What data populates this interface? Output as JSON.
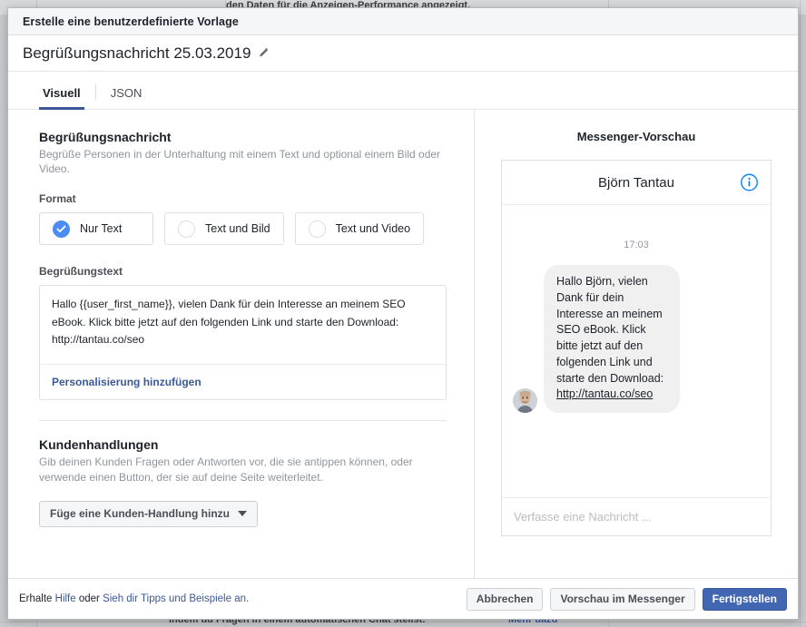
{
  "background": {
    "top_text": "den Daten für die Anzeigen-Performance angezeigt.",
    "bottom_text": "indem du Fragen in einem automatischen Chat stellst.",
    "bottom_link": "Mehr dazu"
  },
  "modal": {
    "header_title": "Erstelle eine benutzerdefinierte Vorlage",
    "doc_title": "Begrüßungsnachricht 25.03.2019",
    "edit_icon": "pencil-icon",
    "tabs": [
      {
        "label": "Visuell",
        "active": true
      },
      {
        "label": "JSON",
        "active": false
      }
    ]
  },
  "greeting_section": {
    "title": "Begrüßungsnachricht",
    "description": "Begrüße Personen in der Unterhaltung mit einem Text und optional einem Bild oder Video.",
    "format_label": "Format",
    "format_options": [
      {
        "label": "Nur Text",
        "selected": true
      },
      {
        "label": "Text und Bild",
        "selected": false
      },
      {
        "label": "Text und Video",
        "selected": false
      }
    ],
    "greeting_text_label": "Begrüßungstext",
    "greeting_text_value": "Hallo {{user_first_name}}, vielen Dank für dein Interesse an meinem SEO eBook. Klick bitte jetzt auf den folgenden Link und starte den Download: http://tantau.co/seo",
    "personalization_link": "Personalisierung hinzufügen"
  },
  "customer_actions": {
    "title": "Kundenhandlungen",
    "description": "Gib deinen Kunden Fragen oder Antworten vor, die sie antippen können, oder verwende einen Button, der sie auf deine Seite weiterleitet.",
    "add_button": "Füge eine Kunden-Handlung hinzu"
  },
  "preview": {
    "heading": "Messenger-Vorschau",
    "contact_name": "Björn Tantau",
    "info_icon": "info-circle-icon",
    "timestamp": "17:03",
    "message_text": "Hallo Björn, vielen Dank für dein Interesse an meinem SEO eBook. Klick bitte jetzt auf den folgenden Link und starte den Download: ",
    "message_link": "http://tantau.co/seo",
    "compose_placeholder": "Verfasse eine Nachricht ..."
  },
  "footer": {
    "note_prefix": "Erhalte ",
    "help_link": "Hilfe",
    "note_middle": " oder ",
    "tips_link": "Sieh dir Tipps und Beispiele an.",
    "cancel_label": "Abbrechen",
    "preview_label": "Vorschau im Messenger",
    "submit_label": "Fertigstellen"
  },
  "colors": {
    "accent_blue": "#4267b2",
    "link_blue": "#3b5998",
    "radio_blue": "#4e8cf5",
    "info_blue": "#0084ff"
  }
}
